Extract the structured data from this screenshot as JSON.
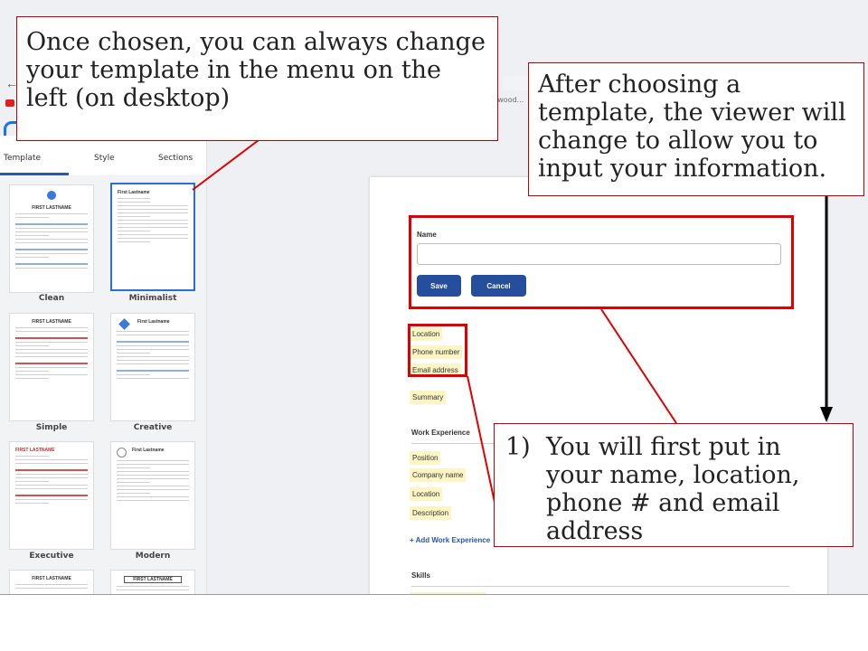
{
  "browser": {
    "back_glyph": "←",
    "tab_fragment": "of wood..."
  },
  "sidebar": {
    "tabs": [
      "Template",
      "Style",
      "Sections"
    ],
    "templates": [
      {
        "label": "Clean",
        "name_text": "FIRST LASTNAME"
      },
      {
        "label": "Minimalist",
        "name_text": "First Lastname"
      },
      {
        "label": "Simple",
        "name_text": "FIRST LASTNAME"
      },
      {
        "label": "Creative",
        "name_text": "First Lastname"
      },
      {
        "label": "Executive",
        "name_text": "FIRST LASTNAME"
      },
      {
        "label": "Modern",
        "name_text": "First Lastname"
      },
      {
        "label": "",
        "name_text": "FIRST LASTNAME"
      },
      {
        "label": "",
        "name_text": "FIRST LASTNAME"
      }
    ]
  },
  "editor": {
    "name_label": "Name",
    "name_value": "",
    "save_label": "Save",
    "cancel_label": "Cancel",
    "location": "Location",
    "phone": "Phone number",
    "email": "Email address",
    "summary": "Summary",
    "work_experience_title": "Work Experience",
    "work_fields": [
      "Position",
      "Company name",
      "Location",
      "Description"
    ],
    "add_work_experience": "+ Add Work Experience",
    "skills_title": "Skills"
  },
  "callouts": {
    "top_left": "Once chosen, you can always change your template in the menu on the left (on desktop)",
    "top_right": "After choosing a template, the viewer will change to allow you to input your information.",
    "bottom_right_number": "1)",
    "bottom_right_text": "You will first put in your name, location, phone # and email address"
  },
  "colors": {
    "callout_border": "#c00000",
    "highlight_box": "#e00000",
    "button": "#254f9c",
    "field_highlight": "#fdf6c4"
  }
}
